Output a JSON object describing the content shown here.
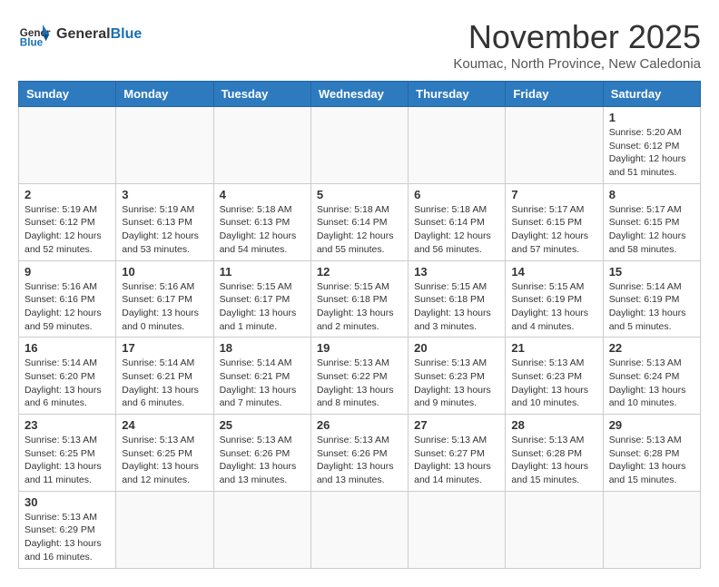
{
  "header": {
    "logo_general": "General",
    "logo_blue": "Blue",
    "month_title": "November 2025",
    "location": "Koumac, North Province, New Caledonia"
  },
  "weekdays": [
    "Sunday",
    "Monday",
    "Tuesday",
    "Wednesday",
    "Thursday",
    "Friday",
    "Saturday"
  ],
  "weeks": [
    [
      {
        "day": "",
        "info": ""
      },
      {
        "day": "",
        "info": ""
      },
      {
        "day": "",
        "info": ""
      },
      {
        "day": "",
        "info": ""
      },
      {
        "day": "",
        "info": ""
      },
      {
        "day": "",
        "info": ""
      },
      {
        "day": "1",
        "info": "Sunrise: 5:20 AM\nSunset: 6:12 PM\nDaylight: 12 hours and 51 minutes."
      }
    ],
    [
      {
        "day": "2",
        "info": "Sunrise: 5:19 AM\nSunset: 6:12 PM\nDaylight: 12 hours and 52 minutes."
      },
      {
        "day": "3",
        "info": "Sunrise: 5:19 AM\nSunset: 6:13 PM\nDaylight: 12 hours and 53 minutes."
      },
      {
        "day": "4",
        "info": "Sunrise: 5:18 AM\nSunset: 6:13 PM\nDaylight: 12 hours and 54 minutes."
      },
      {
        "day": "5",
        "info": "Sunrise: 5:18 AM\nSunset: 6:14 PM\nDaylight: 12 hours and 55 minutes."
      },
      {
        "day": "6",
        "info": "Sunrise: 5:18 AM\nSunset: 6:14 PM\nDaylight: 12 hours and 56 minutes."
      },
      {
        "day": "7",
        "info": "Sunrise: 5:17 AM\nSunset: 6:15 PM\nDaylight: 12 hours and 57 minutes."
      },
      {
        "day": "8",
        "info": "Sunrise: 5:17 AM\nSunset: 6:15 PM\nDaylight: 12 hours and 58 minutes."
      }
    ],
    [
      {
        "day": "9",
        "info": "Sunrise: 5:16 AM\nSunset: 6:16 PM\nDaylight: 12 hours and 59 minutes."
      },
      {
        "day": "10",
        "info": "Sunrise: 5:16 AM\nSunset: 6:17 PM\nDaylight: 13 hours and 0 minutes."
      },
      {
        "day": "11",
        "info": "Sunrise: 5:15 AM\nSunset: 6:17 PM\nDaylight: 13 hours and 1 minute."
      },
      {
        "day": "12",
        "info": "Sunrise: 5:15 AM\nSunset: 6:18 PM\nDaylight: 13 hours and 2 minutes."
      },
      {
        "day": "13",
        "info": "Sunrise: 5:15 AM\nSunset: 6:18 PM\nDaylight: 13 hours and 3 minutes."
      },
      {
        "day": "14",
        "info": "Sunrise: 5:15 AM\nSunset: 6:19 PM\nDaylight: 13 hours and 4 minutes."
      },
      {
        "day": "15",
        "info": "Sunrise: 5:14 AM\nSunset: 6:19 PM\nDaylight: 13 hours and 5 minutes."
      }
    ],
    [
      {
        "day": "16",
        "info": "Sunrise: 5:14 AM\nSunset: 6:20 PM\nDaylight: 13 hours and 6 minutes."
      },
      {
        "day": "17",
        "info": "Sunrise: 5:14 AM\nSunset: 6:21 PM\nDaylight: 13 hours and 6 minutes."
      },
      {
        "day": "18",
        "info": "Sunrise: 5:14 AM\nSunset: 6:21 PM\nDaylight: 13 hours and 7 minutes."
      },
      {
        "day": "19",
        "info": "Sunrise: 5:13 AM\nSunset: 6:22 PM\nDaylight: 13 hours and 8 minutes."
      },
      {
        "day": "20",
        "info": "Sunrise: 5:13 AM\nSunset: 6:23 PM\nDaylight: 13 hours and 9 minutes."
      },
      {
        "day": "21",
        "info": "Sunrise: 5:13 AM\nSunset: 6:23 PM\nDaylight: 13 hours and 10 minutes."
      },
      {
        "day": "22",
        "info": "Sunrise: 5:13 AM\nSunset: 6:24 PM\nDaylight: 13 hours and 10 minutes."
      }
    ],
    [
      {
        "day": "23",
        "info": "Sunrise: 5:13 AM\nSunset: 6:25 PM\nDaylight: 13 hours and 11 minutes."
      },
      {
        "day": "24",
        "info": "Sunrise: 5:13 AM\nSunset: 6:25 PM\nDaylight: 13 hours and 12 minutes."
      },
      {
        "day": "25",
        "info": "Sunrise: 5:13 AM\nSunset: 6:26 PM\nDaylight: 13 hours and 13 minutes."
      },
      {
        "day": "26",
        "info": "Sunrise: 5:13 AM\nSunset: 6:26 PM\nDaylight: 13 hours and 13 minutes."
      },
      {
        "day": "27",
        "info": "Sunrise: 5:13 AM\nSunset: 6:27 PM\nDaylight: 13 hours and 14 minutes."
      },
      {
        "day": "28",
        "info": "Sunrise: 5:13 AM\nSunset: 6:28 PM\nDaylight: 13 hours and 15 minutes."
      },
      {
        "day": "29",
        "info": "Sunrise: 5:13 AM\nSunset: 6:28 PM\nDaylight: 13 hours and 15 minutes."
      }
    ],
    [
      {
        "day": "30",
        "info": "Sunrise: 5:13 AM\nSunset: 6:29 PM\nDaylight: 13 hours and 16 minutes."
      },
      {
        "day": "",
        "info": ""
      },
      {
        "day": "",
        "info": ""
      },
      {
        "day": "",
        "info": ""
      },
      {
        "day": "",
        "info": ""
      },
      {
        "day": "",
        "info": ""
      },
      {
        "day": "",
        "info": ""
      }
    ]
  ]
}
